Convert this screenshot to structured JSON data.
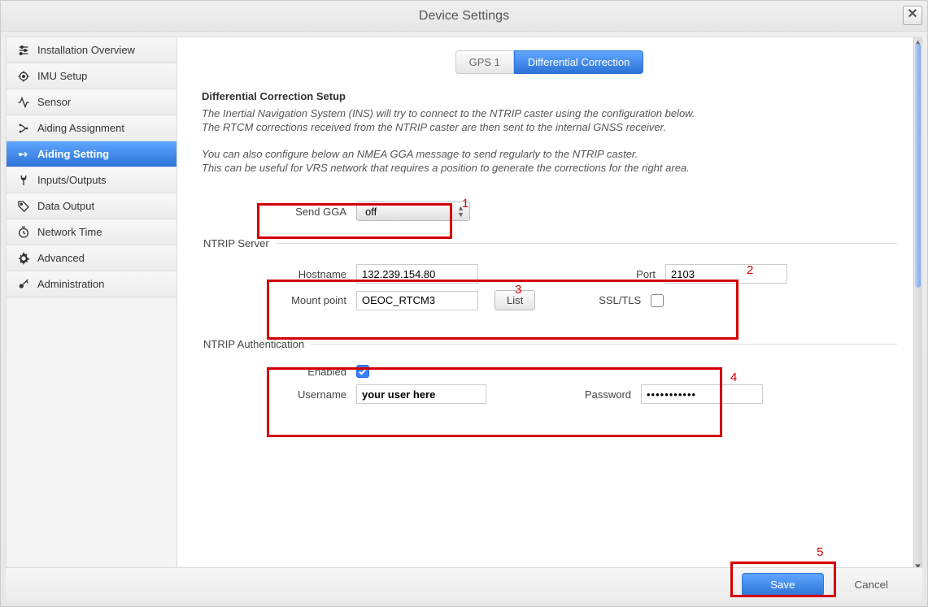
{
  "window": {
    "title": "Device Settings",
    "close": "✕"
  },
  "sidebar": {
    "items": [
      {
        "label": "Installation Overview"
      },
      {
        "label": "IMU Setup"
      },
      {
        "label": "Sensor"
      },
      {
        "label": "Aiding Assignment"
      },
      {
        "label": "Aiding Setting"
      },
      {
        "label": "Inputs/Outputs"
      },
      {
        "label": "Data Output"
      },
      {
        "label": "Network Time"
      },
      {
        "label": "Advanced"
      },
      {
        "label": "Administration"
      }
    ]
  },
  "tabs": {
    "gps1": "GPS 1",
    "diff": "Differential Correction"
  },
  "section": {
    "title": "Differential Correction Setup",
    "line1": "The Inertial Navigation System (INS) will try to connect to the NTRIP caster using the configuration below.",
    "line2": "The RTCM corrections received from the NTRIP caster are then sent to the internal GNSS receiver.",
    "line3": "You can also configure below an NMEA GGA message to send regularly to the NTRIP caster.",
    "line4": "This can be useful for VRS network that requires a position to generate the corrections for the right area."
  },
  "gga": {
    "label": "Send GGA",
    "value": "off"
  },
  "ntrip_server": {
    "legend": "NTRIP Server",
    "hostname_label": "Hostname",
    "hostname": "132.239.154.80",
    "port_label": "Port",
    "port": "2103",
    "mount_label": "Mount point",
    "mount": "OEOC_RTCM3",
    "list_btn": "List",
    "ssl_label": "SSL/TLS",
    "ssl_checked": false
  },
  "ntrip_auth": {
    "legend": "NTRIP Authentication",
    "enabled_label": "Enabled",
    "enabled": true,
    "username_label": "Username",
    "username": "your user here",
    "password_label": "Password",
    "password": "•••••••••••"
  },
  "footer": {
    "save": "Save",
    "cancel": "Cancel"
  },
  "annotations": {
    "a1": "1",
    "a2": "2",
    "a3": "3",
    "a4": "4",
    "a5": "5"
  }
}
